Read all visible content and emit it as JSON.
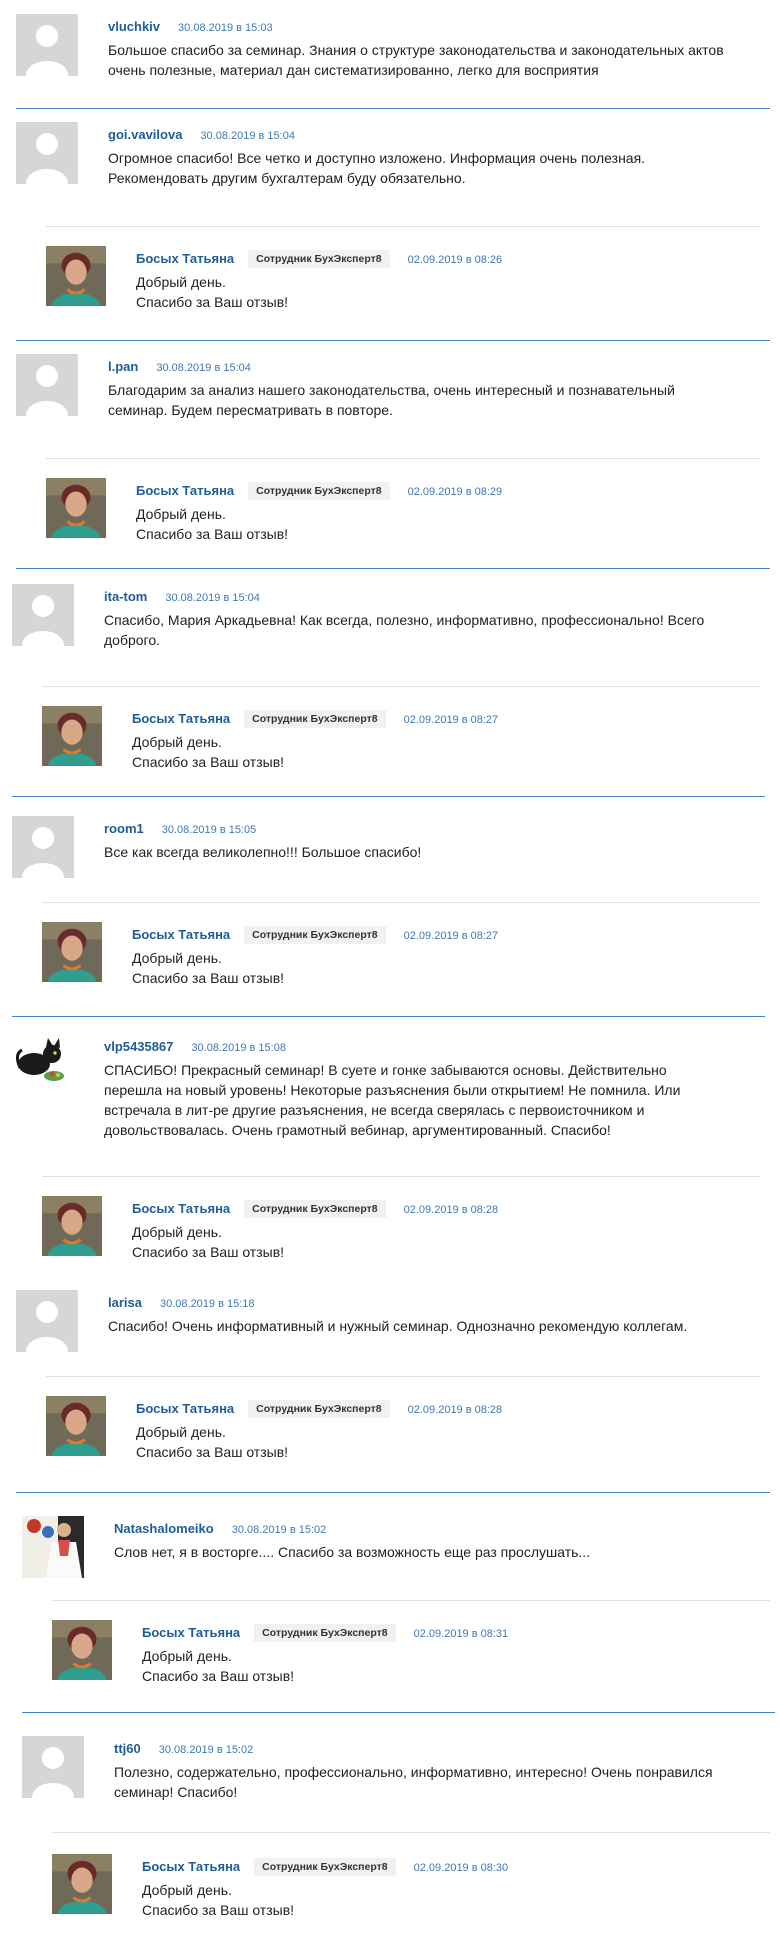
{
  "labels": {
    "staff_badge": "Сотрудник БухЭксперт8",
    "date_sep": "в"
  },
  "comments": [
    {
      "author": "vluchkiv",
      "date": "30.08.2019",
      "time": "15:03",
      "avatar": "default",
      "lines": [
        "Большое спасибо за семинар. Знания о структуре законодательства и законодательных актов",
        "очень полезные, материал дан систематизированно, легко для восприятия"
      ]
    },
    {
      "author": "goi.vavilova",
      "date": "30.08.2019",
      "time": "15:04",
      "avatar": "default",
      "lines": [
        "Огромное спасибо! Все четко и доступно изложено. Информация очень полезная.",
        "Рекомендовать другим бухгалтерам буду обязательно."
      ],
      "reply": {
        "author": "Босых Татьяна",
        "date": "02.09.2019",
        "time": "08:26",
        "lines": [
          "Добрый день.",
          "Спасибо за Ваш отзыв!"
        ]
      }
    },
    {
      "author": "l.pan",
      "date": "30.08.2019",
      "time": "15:04",
      "avatar": "default",
      "lines": [
        "Благодарим за анализ нашего законодательства, очень интересный и познавательный",
        "семинар. Будем пересматривать в повторе."
      ],
      "reply": {
        "author": "Босых Татьяна",
        "date": "02.09.2019",
        "time": "08:29",
        "lines": [
          "Добрый день.",
          "Спасибо за Ваш отзыв!"
        ]
      }
    },
    {
      "author": "ita-tom",
      "date": "30.08.2019",
      "time": "15:04",
      "avatar": "default",
      "lines": [
        "Спасибо, Мария Аркадьевна! Как всегда, полезно, информативно, профессионально! Всего",
        "доброго."
      ],
      "reply": {
        "author": "Босых Татьяна",
        "date": "02.09.2019",
        "time": "08:27",
        "lines": [
          "Добрый день.",
          "Спасибо за Ваш отзыв!"
        ]
      }
    },
    {
      "author": "room1",
      "date": "30.08.2019",
      "time": "15:05",
      "avatar": "default",
      "lines": [
        "Все как всегда великолепно!!! Большое спасибо!"
      ],
      "reply": {
        "author": "Босых Татьяна",
        "date": "02.09.2019",
        "time": "08:27",
        "lines": [
          "Добрый день.",
          "Спасибо за Ваш отзыв!"
        ]
      }
    },
    {
      "author": "vlp5435867",
      "date": "30.08.2019",
      "time": "15:08",
      "avatar": "cat",
      "lines": [
        "СПАСИБО! Прекрасный семинар! В суете и гонке забываются основы. Действительно",
        "перешла на новый уровень! Некоторые разъяснения были открытием! Не помнила. Или",
        "встречала в лит-ре другие разъяснения, не всегда сверялась с первоисточником и",
        "довольствовалась. Очень грамотный вебинар, аргументированный. Спасибо!"
      ],
      "reply": {
        "author": "Босых Татьяна",
        "date": "02.09.2019",
        "time": "08:28",
        "lines": [
          "Добрый день.",
          "Спасибо за Ваш отзыв!"
        ]
      }
    },
    {
      "author": "larisa",
      "date": "30.08.2019",
      "time": "15:18",
      "avatar": "default",
      "lines": [
        "Спасибо! Очень информативный и нужный семинар. Однозначно рекомендую коллегам."
      ],
      "reply": {
        "author": "Босых Татьяна",
        "date": "02.09.2019",
        "time": "08:28",
        "lines": [
          "Добрый день.",
          "Спасибо за Ваш отзыв!"
        ]
      }
    },
    {
      "author": "Natashalomeiko",
      "date": "30.08.2019",
      "time": "15:02",
      "avatar": "photo",
      "lines": [
        "Слов нет, я в восторге.... Спасибо за возможность еще раз прослушать..."
      ],
      "reply": {
        "author": "Босых Татьяна",
        "date": "02.09.2019",
        "time": "08:31",
        "lines": [
          "Добрый день.",
          "Спасибо за Ваш отзыв!"
        ]
      }
    },
    {
      "author": "ttj60",
      "date": "30.08.2019",
      "time": "15:02",
      "avatar": "default",
      "lines": [
        "Полезно, содержательно, профессионально, информативно, интересно! Очень понравился",
        "семинар! Спасибо!"
      ],
      "reply": {
        "author": "Босых Татьяна",
        "date": "02.09.2019",
        "time": "08:30",
        "lines": [
          "Добрый день.",
          "Спасибо за Ваш отзыв!"
        ]
      }
    }
  ]
}
